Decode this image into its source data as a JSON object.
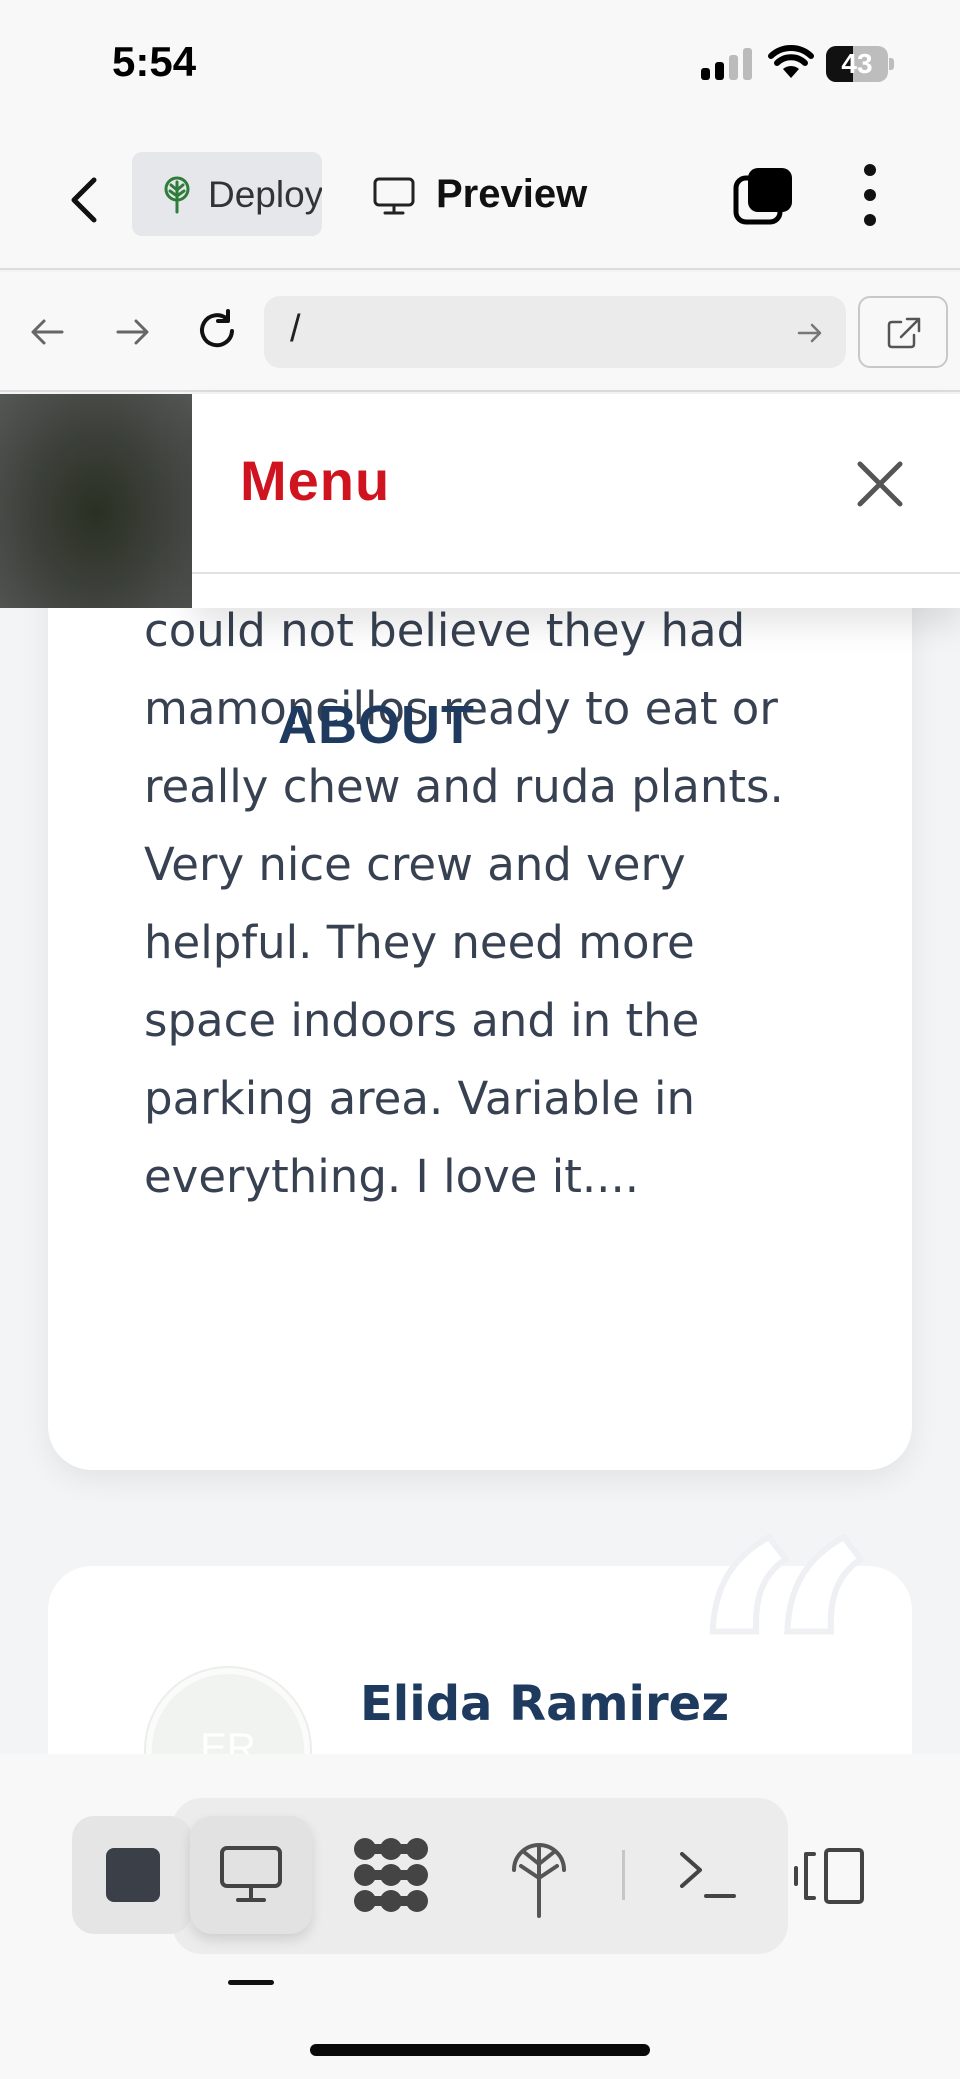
{
  "status_bar": {
    "time": "5:54",
    "battery_percent": "43",
    "battery_level": 0.43,
    "signal_bars_active": 2,
    "signal_bars_total": 4
  },
  "app_toolbar": {
    "deploy_label": "Deploy",
    "preview_label": "Preview",
    "icons": [
      "chevron-left-icon",
      "deploy-tree-icon",
      "monitor-icon",
      "tabs-icon",
      "more-vertical-icon"
    ]
  },
  "browser": {
    "url": "/",
    "icons": [
      "arrow-left-icon",
      "arrow-right-icon",
      "reload-icon",
      "go-arrow-icon",
      "external-link-icon"
    ]
  },
  "menu": {
    "title": "Menu",
    "title_color": "#d0141f"
  },
  "page": {
    "about_label": "ABOUT",
    "review_text": "They have fresh produce, I could not believe they had mamoncillos ready to eat or really chew and ruda plants. Very nice crew and very helpful. They need more space indoors and in the parking area. Variable in everything. I love it....",
    "reviewer_initials": "ER",
    "reviewer_name": "Elida Ramirez",
    "quote_mark": "“"
  },
  "bottom_toolbar": {
    "icons": [
      "stop-icon",
      "monitor-icon",
      "pattern-grid-icon",
      "deploy-icon",
      "terminal-icon",
      "responsive-icon"
    ],
    "active": "monitor-icon"
  },
  "colors": {
    "accent_red": "#d0141f",
    "navy": "#1e3a5f",
    "body_text": "#374151"
  }
}
